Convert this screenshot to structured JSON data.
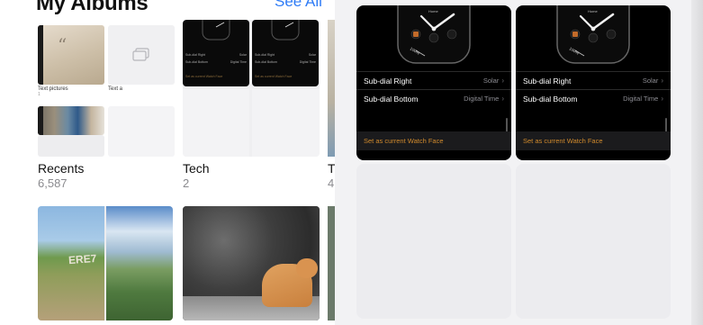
{
  "albums": {
    "title": "My Albums",
    "see_all": "See All",
    "recents": {
      "name": "Recents",
      "count": "6,587",
      "grid": [
        {
          "label": "Text pictures",
          "count": "1"
        },
        {
          "label": "Text a",
          "count": "1"
        }
      ]
    },
    "tech": {
      "name": "Tech",
      "count": "2",
      "mini_rows": [
        {
          "label": "Sub-dial Right",
          "value": "Solar"
        },
        {
          "label": "Sub-dial Bottom",
          "value": "Digital Time"
        }
      ],
      "mini_action": "Set as current Watch Face"
    },
    "third": {
      "name_initial": "T",
      "count_initial": "4"
    }
  },
  "watch_face": {
    "rows": [
      {
        "label": "Sub-dial Right",
        "value": "Solar"
      },
      {
        "label": "Sub-dial Bottom",
        "value": "Digital Time"
      }
    ],
    "action": "Set as current Watch Face",
    "face_labels": {
      "top": "Home",
      "inner": "100%"
    }
  },
  "icons": {
    "chevron": "chevron-right-icon",
    "duplicate": "stack-photos-icon"
  },
  "colors": {
    "accent_blue": "#2f7cf6",
    "action_orange": "#d08a2d",
    "dark_bg": "#000000"
  }
}
